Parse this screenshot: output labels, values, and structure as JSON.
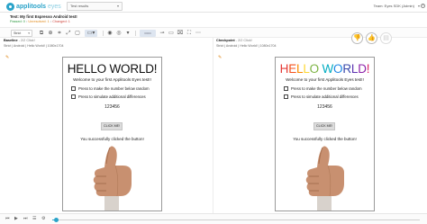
{
  "app": {
    "logo_brand": "applitools",
    "logo_suffix": "eyes",
    "results_tab": "Test results",
    "user": "Team: Eyes SDK (Admin)"
  },
  "test": {
    "title": "Test: My first Espresso Android test!",
    "statuses": {
      "passed": "Passed: 0",
      "unresolved": "Unresolved: 1",
      "changed": "Changed: 1"
    }
  },
  "toolbar": {
    "match_level": "Strict",
    "view_mode": "BL | CP",
    "zoom": "▭▭"
  },
  "baseline": {
    "label": "Baseline",
    "step": "- 2/2 Click!",
    "meta": "Strict | Android | Hello World! | 1080x1704"
  },
  "checkpoint": {
    "label": "Checkpoint",
    "step": "- 2/2 Click!",
    "meta": "Strict | Android | Hello World! | 1080x1704"
  },
  "device_screen": {
    "hello": "HELLO WORLD!",
    "hello_letters": [
      "H",
      "E",
      "L",
      "L",
      "O",
      " ",
      "W",
      "O",
      "R",
      "L",
      "D",
      "!"
    ],
    "welcome": "Welcome to your first Applitools Eyes test!!",
    "checkbox_random": "Press to make the number below random",
    "checkbox_diff": "Press to simulate additional differences",
    "number": "123456",
    "button": "CLICK ME!",
    "clicked": "You successfully clicked the button!"
  },
  "playback": {
    "progress": 0.01
  },
  "colors": {
    "brand": "#2aa3c9",
    "passed": "#2e9a41",
    "unresolved": "#e0891a",
    "changed": "#d0453c"
  }
}
